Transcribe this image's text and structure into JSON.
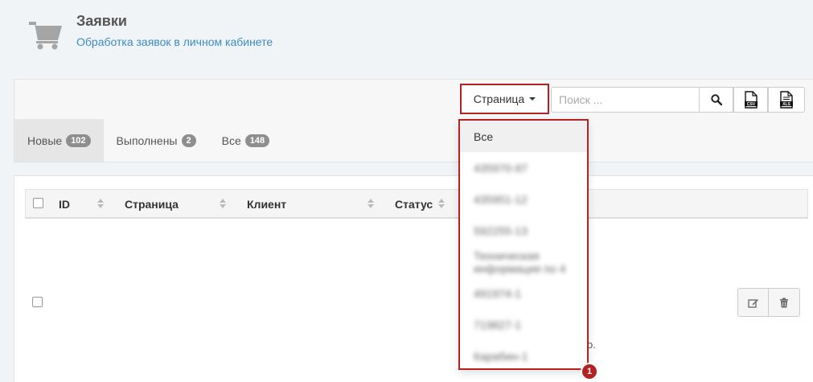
{
  "header": {
    "title": "Заявки",
    "subtitle": "Обработка заявок в личном кабинете"
  },
  "tabs": [
    {
      "label": "Новые",
      "count": "102"
    },
    {
      "label": "Выполнены",
      "count": "2"
    },
    {
      "label": "Все",
      "count": "148"
    }
  ],
  "toolbar": {
    "page_filter_label": "Страница",
    "search_placeholder": "Поиск ..."
  },
  "table": {
    "columns": [
      "ID",
      "Страница",
      "Клиент",
      "Статус"
    ],
    "row_trailing_text": "o."
  },
  "dropdown": {
    "items": [
      "Все",
      "435970-97",
      "435951-12",
      "592255-13",
      "Техническая информация по 4",
      "491974-1",
      "719827-1",
      "Карабин-1"
    ]
  },
  "annotation": {
    "marker": "1",
    "color": "#b22222"
  },
  "icons": [
    "cart-icon",
    "search-icon",
    "csv-file-icon",
    "xls-file-icon",
    "sort-icon",
    "edit-icon",
    "trash-icon"
  ]
}
